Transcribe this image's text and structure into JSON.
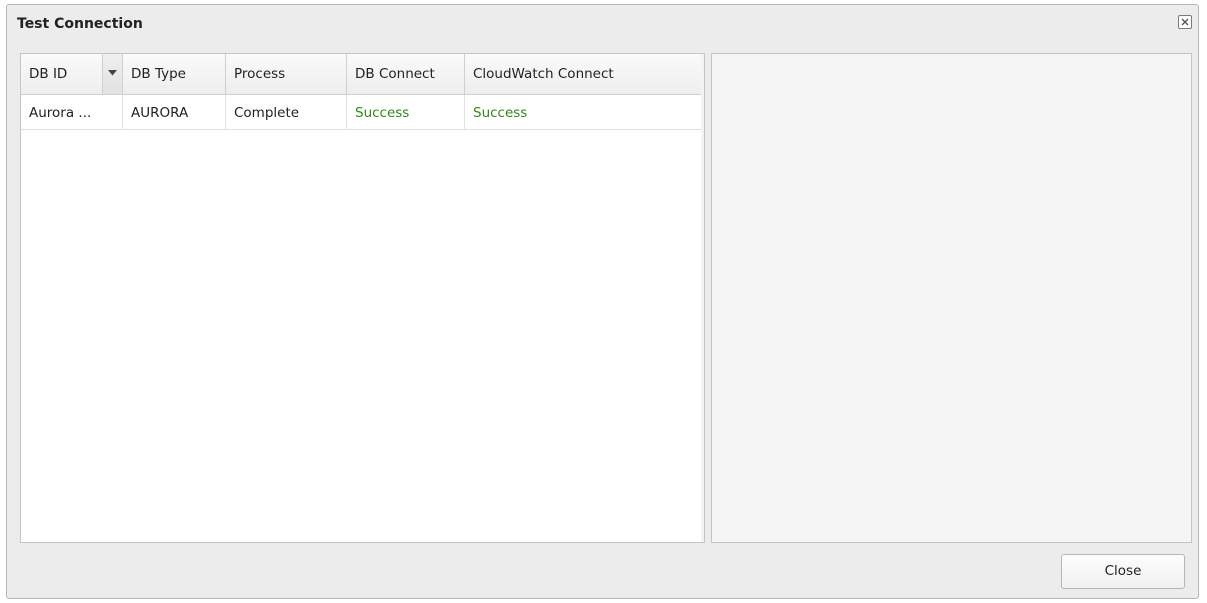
{
  "dialog": {
    "title": "Test Connection",
    "close_button_label": "Close"
  },
  "grid": {
    "columns": [
      {
        "label": "DB ID"
      },
      {
        "label": "DB Type"
      },
      {
        "label": "Process"
      },
      {
        "label": "DB Connect"
      },
      {
        "label": "CloudWatch Connect"
      }
    ],
    "sorted_column": "DB ID",
    "rows": [
      {
        "db_id": "Aurora ...",
        "db_type": "AURORA",
        "process": "Complete",
        "db_connect": "Success",
        "cloudwatch_connect": "Success"
      }
    ]
  },
  "colors": {
    "success": "#2e8b10",
    "dialog_bg": "#ececec",
    "detail_panel_bg": "#f5f5f5"
  },
  "icons": {
    "window_close": "close-icon",
    "column_menu": "chevron-down-icon"
  }
}
